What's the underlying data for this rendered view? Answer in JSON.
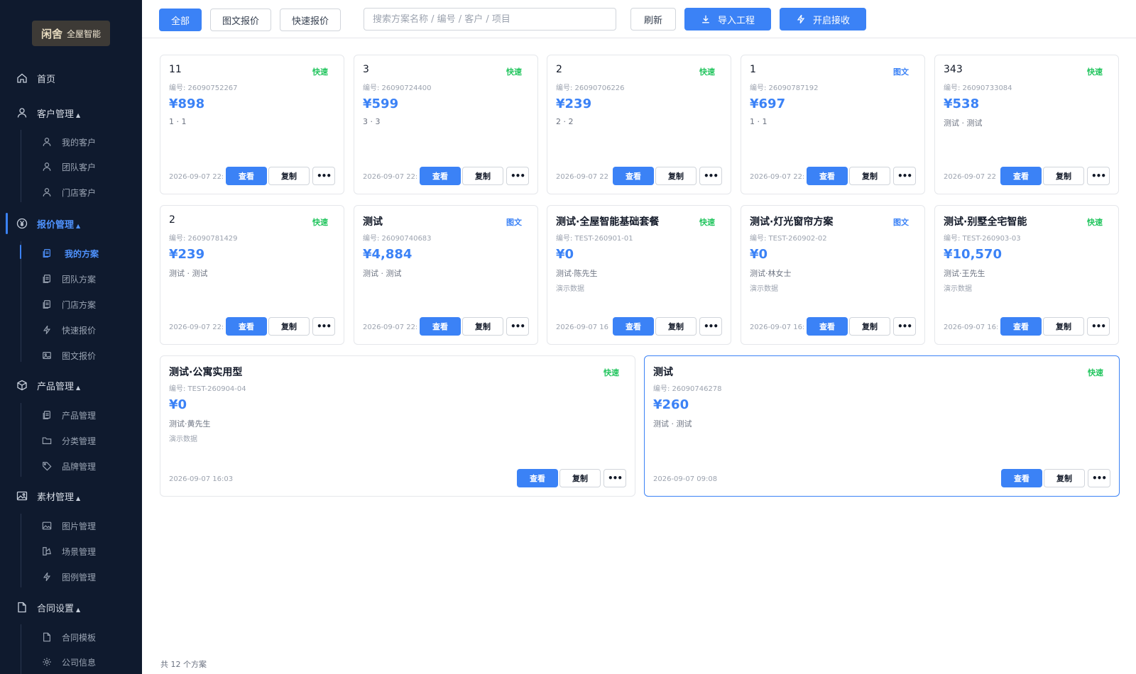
{
  "brand": {
    "mark": "闲舍",
    "text": "全屋智能"
  },
  "sidebar": {
    "home": "首页",
    "customer": {
      "label": "客户管理",
      "items": [
        "我的客户",
        "团队客户",
        "门店客户"
      ]
    },
    "quote": {
      "label": "报价管理",
      "items": [
        "我的方案",
        "团队方案",
        "门店方案",
        "快速报价",
        "图文报价"
      ]
    },
    "product": {
      "label": "产品管理",
      "items": [
        "产品管理",
        "分类管理",
        "品牌管理"
      ]
    },
    "material": {
      "label": "素材管理",
      "items": [
        "图片管理",
        "场景管理",
        "图例管理"
      ]
    },
    "contract": {
      "label": "合同设置",
      "items": [
        "合同模板",
        "公司信息"
      ]
    },
    "caret": "▲"
  },
  "toolbar": {
    "filters": [
      "全部",
      "图文报价",
      "快速报价"
    ],
    "search_placeholder": "搜索方案名称 / 编号 / 客户 / 项目",
    "refresh": "刷新",
    "import": "导入工程",
    "receive": "开启接收"
  },
  "card_actions": {
    "view": "查看",
    "copy": "复制",
    "more": "•••"
  },
  "cards": [
    {
      "title": "11",
      "tag": "快速",
      "code": "编号: 26090752267",
      "price": "¥898",
      "client": "1 · 1",
      "note": "",
      "date": "2026-09-07 22:"
    },
    {
      "title": "3",
      "tag": "快速",
      "code": "编号: 26090724400",
      "price": "¥599",
      "client": "3 · 3",
      "note": "",
      "date": "2026-09-07 22:"
    },
    {
      "title": "2",
      "tag": "快速",
      "code": "编号: 26090706226",
      "price": "¥239",
      "client": "2 · 2",
      "note": "",
      "date": "2026-09-07 22"
    },
    {
      "title": "1",
      "tag": "图文",
      "code": "编号: 26090787192",
      "price": "¥697",
      "client": "1 · 1",
      "note": "",
      "date": "2026-09-07 22:"
    },
    {
      "title": "343",
      "tag": "快速",
      "code": "编号: 26090733084",
      "price": "¥538",
      "client": "测试 · 测试",
      "note": "",
      "date": "2026-09-07 22"
    },
    {
      "title": "2",
      "tag": "快速",
      "code": "编号: 26090781429",
      "price": "¥239",
      "client": "测试 · 测试",
      "note": "",
      "date": "2026-09-07 22:"
    },
    {
      "title": "测试",
      "tag": "图文",
      "code": "编号: 26090740683",
      "price": "¥4,884",
      "client": "测试 · 测试",
      "note": "",
      "date": "2026-09-07 22:"
    },
    {
      "title": "测试·全屋智能基础套餐",
      "tag": "快速",
      "code": "编号: TEST-260901-01",
      "price": "¥0",
      "client": "测试·陈先生",
      "note": "演示数据",
      "date": "2026-09-07 16"
    },
    {
      "title": "测试·灯光窗帘方案",
      "tag": "图文",
      "code": "编号: TEST-260902-02",
      "price": "¥0",
      "client": "测试·林女士",
      "note": "演示数据",
      "date": "2026-09-07 16:"
    },
    {
      "title": "测试·别墅全宅智能",
      "tag": "快速",
      "code": "编号: TEST-260903-03",
      "price": "¥10,570",
      "client": "测试·王先生",
      "note": "演示数据",
      "date": "2026-09-07 16:"
    },
    {
      "title": "测试·公寓实用型",
      "tag": "快速",
      "code": "编号: TEST-260904-04",
      "price": "¥0",
      "client": "测试·黄先生",
      "note": "演示数据",
      "date": "2026-09-07 16:03"
    },
    {
      "title": "测试",
      "tag": "快速",
      "code": "编号: 26090746278",
      "price": "¥260",
      "client": "测试 · 测试",
      "note": "",
      "date": "2026-09-07 09:08"
    }
  ],
  "footer": {
    "count": "共 12 个方案"
  },
  "colors": {
    "accent": "#3b82f6",
    "sidebar_bg": "#0f1a2e",
    "tag_fast": "#22c55e",
    "tag_image": "#3b82f6"
  }
}
